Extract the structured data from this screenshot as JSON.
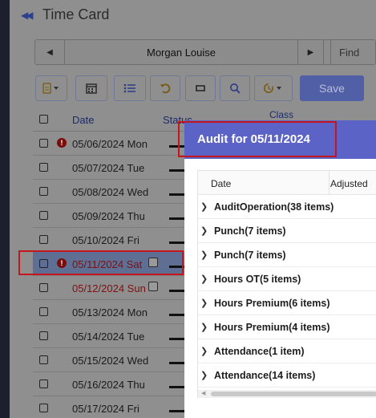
{
  "header": {
    "title": "Time Card"
  },
  "nav": {
    "employee_name": "Morgan Louise",
    "find_label": "Find"
  },
  "toolbar": {
    "save_label": "Save"
  },
  "grid": {
    "columns": {
      "date": "Date",
      "status": "Status",
      "class": "Class"
    },
    "rows": [
      {
        "date": "05/06/2024 Mon",
        "error": true,
        "red": false,
        "selected": false
      },
      {
        "date": "05/07/2024 Tue",
        "error": false,
        "red": false,
        "selected": false
      },
      {
        "date": "05/08/2024 Wed",
        "error": false,
        "red": false,
        "selected": false
      },
      {
        "date": "05/09/2024 Thu",
        "error": false,
        "red": false,
        "selected": false
      },
      {
        "date": "05/10/2024 Fri",
        "error": false,
        "red": false,
        "selected": false
      },
      {
        "date": "05/11/2024 Sat",
        "error": true,
        "red": true,
        "selected": true
      },
      {
        "date": "05/12/2024 Sun",
        "error": false,
        "red": true,
        "selected": false
      },
      {
        "date": "05/13/2024 Mon",
        "error": false,
        "red": false,
        "selected": false
      },
      {
        "date": "05/14/2024 Tue",
        "error": false,
        "red": false,
        "selected": false
      },
      {
        "date": "05/15/2024 Wed",
        "error": false,
        "red": false,
        "selected": false
      },
      {
        "date": "05/16/2024 Thu",
        "error": false,
        "red": false,
        "selected": false
      },
      {
        "date": "05/17/2024 Fri",
        "error": false,
        "red": false,
        "selected": false
      }
    ]
  },
  "audit": {
    "title": "Audit for 05/11/2024",
    "columns": {
      "date": "Date",
      "adjusted": "Adjusted"
    },
    "groups": [
      "AuditOperation(38 items)",
      "Punch(7 items)",
      "Punch(7 items)",
      "Hours OT(5 items)",
      "Hours Premium(6 items)",
      "Hours Premium(4 items)",
      "Attendance(1 item)",
      "Attendance(14 items)"
    ]
  },
  "colors": {
    "accent": "#5b64c6",
    "highlight_border": "#c4161c",
    "error": "#7a0c0c"
  }
}
